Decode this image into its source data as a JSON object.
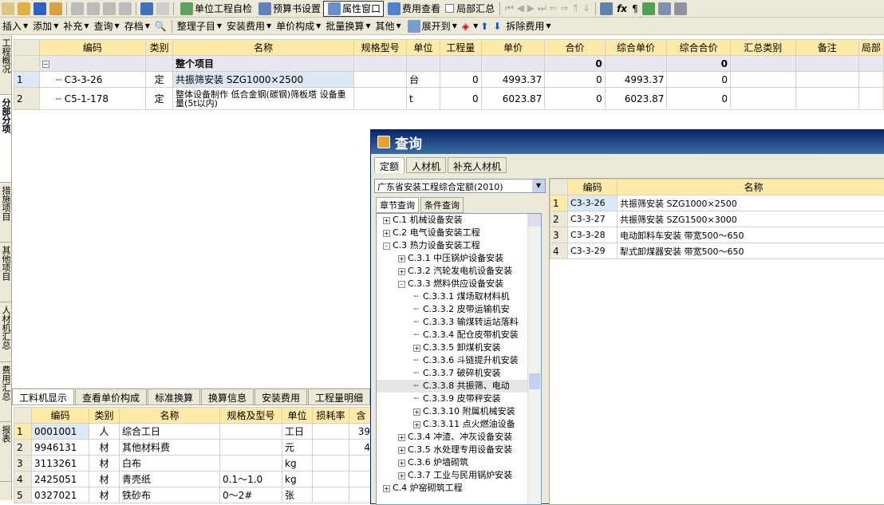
{
  "toolbar1": {
    "check": "单位工程自检",
    "settings": "预算书设置",
    "props": "属性窗口",
    "fee": "费用查看",
    "local": "局部汇总"
  },
  "toolbar2": {
    "insert": "插入",
    "add": "添加",
    "supplement": "补充",
    "query": "查询",
    "archive": "存档",
    "organize": "整理子目",
    "install": "安装费用",
    "price": "单价构成",
    "batch": "批量换算",
    "other": "其他",
    "expand": "展开到",
    "remove": "拆除费用"
  },
  "sidetabs": [
    "工程概况",
    "分部分项",
    "措施项目",
    "其他项目",
    "人材机汇总",
    "费用汇总",
    "报表"
  ],
  "main": {
    "columns": [
      "编码",
      "类别",
      "名称",
      "规格型号",
      "单位",
      "工程量",
      "单价",
      "合价",
      "综合单价",
      "综合合价",
      "汇总类别",
      "备注",
      "局部"
    ],
    "total": {
      "name": "整个项目",
      "hj": "0",
      "zhhj": "0"
    },
    "rows": [
      {
        "no": "1",
        "code": "C3-3-26",
        "type": "定",
        "name": "共振筛安装 SZG1000×2500",
        "unit": "台",
        "qty": "0",
        "price": "4993.37",
        "hj": "0",
        "zhdj": "4993.37",
        "zhhj": "0"
      },
      {
        "no": "2",
        "code": "C5-1-178",
        "type": "定",
        "name": "整体设备制作 低合金钢(碳钢)筛板塔 设备重量(5t以内)",
        "unit": "t",
        "qty": "0",
        "price": "6023.87",
        "hj": "0",
        "zhdj": "6023.87",
        "zhhj": "0"
      }
    ]
  },
  "bottom": {
    "tabs": [
      "工料机显示",
      "查看单价构成",
      "标准换算",
      "换算信息",
      "安装费用",
      "工程量明细"
    ],
    "columns": [
      "编码",
      "类别",
      "名称",
      "规格及型号",
      "单位",
      "损耗率",
      "含"
    ],
    "rows": [
      {
        "no": "1",
        "code": "0001001",
        "type": "人",
        "name": "综合工日",
        "spec": "",
        "unit": "工日",
        "rate": "",
        "q": "39"
      },
      {
        "no": "2",
        "code": "9946131",
        "type": "材",
        "name": "其他材料费",
        "spec": "",
        "unit": "元",
        "rate": "",
        "q": "4"
      },
      {
        "no": "3",
        "code": "3113261",
        "type": "材",
        "name": "白布",
        "spec": "",
        "unit": "kg",
        "rate": "",
        "q": ""
      },
      {
        "no": "4",
        "code": "2425051",
        "type": "材",
        "name": "青壳纸",
        "spec": "0.1～1.0",
        "unit": "kg",
        "rate": "",
        "q": ""
      },
      {
        "no": "5",
        "code": "0327021",
        "type": "材",
        "name": "铁砂布",
        "spec": "0～2#",
        "unit": "张",
        "rate": "",
        "q": ""
      }
    ]
  },
  "dialog": {
    "title": "查询",
    "tabs": [
      "定额",
      "人材机",
      "补充人材机"
    ],
    "quota": "广东省安装工程综合定额(2010)",
    "subtabs": [
      "章节查询",
      "条件查询"
    ],
    "tree": [
      {
        "lvl": 0,
        "e": "+",
        "t": "C.1 机械设备安装"
      },
      {
        "lvl": 0,
        "e": "+",
        "t": "C.2 电气设备安装工程"
      },
      {
        "lvl": 0,
        "e": "-",
        "t": "C.3 热力设备安装工程"
      },
      {
        "lvl": 1,
        "e": "+",
        "t": "C.3.1 中压锅炉设备安装"
      },
      {
        "lvl": 1,
        "e": "+",
        "t": "C.3.2 汽轮发电机设备安装"
      },
      {
        "lvl": 1,
        "e": "-",
        "t": "C.3.3 燃料供应设备安装"
      },
      {
        "lvl": 2,
        "e": "",
        "t": "C.3.3.1 煤场取材料机"
      },
      {
        "lvl": 2,
        "e": "",
        "t": "C.3.3.2 皮带运输机安"
      },
      {
        "lvl": 2,
        "e": "",
        "t": "C.3.3.3 输煤转运站落料"
      },
      {
        "lvl": 2,
        "e": "",
        "t": "C.3.3.4 配仓皮带机安装"
      },
      {
        "lvl": 2,
        "e": "+",
        "t": "C.3.3.5 卸煤机安装"
      },
      {
        "lvl": 2,
        "e": "",
        "t": "C.3.3.6 斗链提升机安装"
      },
      {
        "lvl": 2,
        "e": "",
        "t": "C.3.3.7 破碎机安装"
      },
      {
        "lvl": 2,
        "e": "",
        "t": "C.3.3.8 共振筛、电动",
        "hi": true
      },
      {
        "lvl": 2,
        "e": "",
        "t": "C.3.3.9 皮带秤安装"
      },
      {
        "lvl": 2,
        "e": "+",
        "t": "C.3.3.10 附属机械安装"
      },
      {
        "lvl": 2,
        "e": "+",
        "t": "C.3.3.11 点火燃油设备"
      },
      {
        "lvl": 1,
        "e": "+",
        "t": "C.3.4 冲渣、冲灰设备安装"
      },
      {
        "lvl": 1,
        "e": "+",
        "t": "C.3.5 水处理专用设备安装"
      },
      {
        "lvl": 1,
        "e": "+",
        "t": "C.3.6 炉墙砌筑"
      },
      {
        "lvl": 1,
        "e": "+",
        "t": "C.3.7 工业与民用锅炉安装"
      },
      {
        "lvl": 0,
        "e": "+",
        "t": "C.4 炉窑砌筑工程"
      }
    ],
    "rcols": [
      "编码",
      "名称"
    ],
    "results": [
      {
        "no": "1",
        "code": "C3-3-26",
        "name": "共振筛安装 SZG1000×2500"
      },
      {
        "no": "2",
        "code": "C3-3-27",
        "name": "共振筛安装 SZG1500×3000"
      },
      {
        "no": "3",
        "code": "C3-3-28",
        "name": "电动卸料车安装 带宽500～650"
      },
      {
        "no": "4",
        "code": "C3-3-29",
        "name": "犁式卸煤器安装 带宽500～650"
      }
    ]
  }
}
